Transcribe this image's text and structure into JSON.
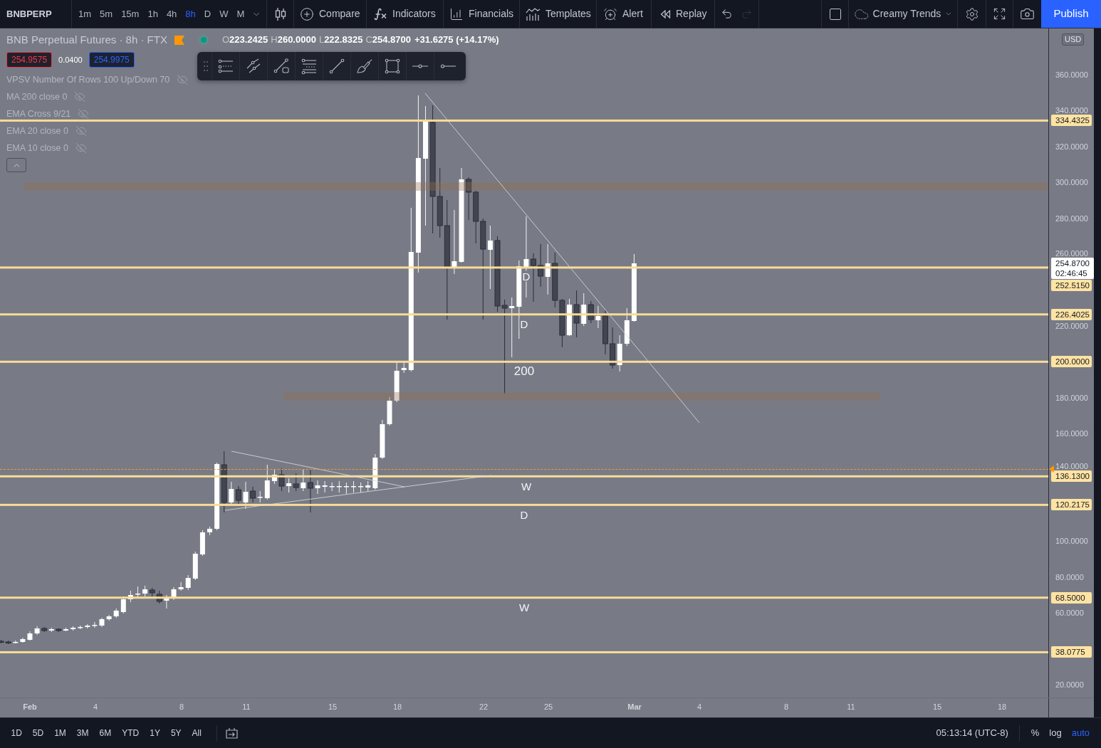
{
  "top_toolbar": {
    "symbol": "BNBPERP",
    "intervals": [
      {
        "label": "1m",
        "selected": false
      },
      {
        "label": "5m",
        "selected": false
      },
      {
        "label": "15m",
        "selected": false
      },
      {
        "label": "1h",
        "selected": false
      },
      {
        "label": "4h",
        "selected": false
      },
      {
        "label": "8h",
        "selected": true
      },
      {
        "label": "D",
        "selected": false
      },
      {
        "label": "W",
        "selected": false
      },
      {
        "label": "M",
        "selected": false
      }
    ],
    "tools": [
      {
        "kind": "compare",
        "label": "Compare"
      },
      {
        "kind": "indicators",
        "label": "Indicators"
      },
      {
        "kind": "financials",
        "label": "Financials"
      },
      {
        "kind": "templates",
        "label": "Templates"
      },
      {
        "kind": "alert",
        "label": "Alert"
      },
      {
        "kind": "replay",
        "label": "Replay"
      }
    ],
    "history": [
      {
        "kind": "undo",
        "disabled": false
      },
      {
        "kind": "redo",
        "disabled": true
      }
    ],
    "layout_name": "Creamy Trends",
    "publish_label": "Publish"
  },
  "legend": {
    "title": "BNB Perpetual Futures · 8h · FTX",
    "ohlc": [
      {
        "key": "O",
        "value": "223.2425"
      },
      {
        "key": "H",
        "value": "260.0000"
      },
      {
        "key": "L",
        "value": "222.8325"
      },
      {
        "key": "C",
        "value": "254.8700"
      }
    ],
    "change": "+31.6275 (+14.17%)",
    "bid": "254.9575",
    "spread": "0.0400",
    "ask": "254.9975",
    "indicators": [
      {
        "label": "VPSV Number Of Rows 100 Up/Down 70",
        "hidden": true
      },
      {
        "label": "MA 200 close 0",
        "hidden": true
      },
      {
        "label": "EMA Cross 9/21",
        "hidden": true
      },
      {
        "label": "EMA 20 close 0",
        "hidden": true
      },
      {
        "label": "EMA 10 close 0",
        "hidden": true
      }
    ]
  },
  "chart": {
    "annotations": [
      "D",
      "D",
      "200",
      "W",
      "D",
      "W"
    ],
    "levels": [
      "334.4325",
      "252.5150",
      "226.4025",
      "200.0000",
      "136.1300",
      "120.2175",
      "68.5000",
      "38.0775"
    ],
    "last_price": {
      "price": "254.8700",
      "countdown": "02:46:45"
    },
    "currency": "USD",
    "price_ticks": [
      "360.0000",
      "340.0000",
      "320.0000",
      "300.0000",
      "280.0000",
      "260.0000",
      "220.0000",
      "180.0000",
      "160.0000",
      "140.0000",
      "100.0000",
      "80.0000",
      "60.0000",
      "20.0000"
    ],
    "time_ticks": [
      {
        "label": "Feb",
        "kind": "month"
      },
      {
        "label": "4",
        "kind": "day"
      },
      {
        "label": "8",
        "kind": "day"
      },
      {
        "label": "11",
        "kind": "day"
      },
      {
        "label": "15",
        "kind": "day"
      },
      {
        "label": "18",
        "kind": "day"
      },
      {
        "label": "22",
        "kind": "day"
      },
      {
        "label": "25",
        "kind": "day"
      },
      {
        "label": "Mar",
        "kind": "month"
      },
      {
        "label": "4",
        "kind": "day"
      },
      {
        "label": "8",
        "kind": "day"
      },
      {
        "label": "11",
        "kind": "day"
      },
      {
        "label": "15",
        "kind": "day"
      },
      {
        "label": "18",
        "kind": "day"
      }
    ]
  },
  "bottom_bar": {
    "ranges": [
      "1D",
      "5D",
      "1M",
      "3M",
      "6M",
      "YTD",
      "1Y",
      "5Y",
      "All"
    ],
    "clock": "05:13:14 (UTC-8)",
    "options": [
      {
        "label": "%",
        "selected": false
      },
      {
        "label": "log",
        "selected": false
      },
      {
        "label": "auto",
        "selected": true
      }
    ]
  }
}
